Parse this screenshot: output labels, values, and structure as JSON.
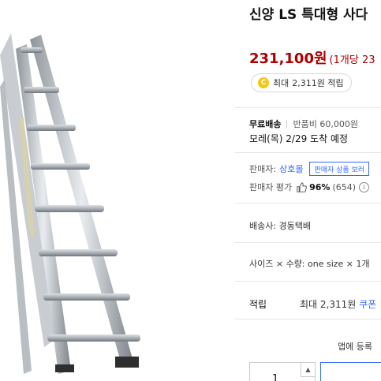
{
  "product": {
    "title": "신양 LS 특대형 사다",
    "price": "231,100원",
    "unit_price": "(1개당 23",
    "reward_label": "최대",
    "reward_amount": "2,311원 적립",
    "coin_symbol": "C"
  },
  "shipping": {
    "free": "무료배송",
    "return_fee": "반품비 60,000원",
    "arrival": "모레(목) 2/29 도착 예정"
  },
  "seller": {
    "label": "판매자:",
    "name": "상호몰",
    "tooltip": "판매자 상품 보러",
    "rating_label": "판매자 평가",
    "rating_pct": "96%",
    "rating_count": "(654)",
    "info_symbol": "i"
  },
  "delivery": {
    "text": "배송사: 경동택배"
  },
  "options": {
    "text": "사이즈 × 수량: one size × 1개"
  },
  "rewards": {
    "label": "적립",
    "value": "최대 2,311원 ",
    "link": "쿠폰"
  },
  "app": {
    "text": "앱에 등록"
  },
  "quantity": {
    "value": "1",
    "up_symbol": "▲"
  },
  "colors": {
    "price_red": "#ae0000",
    "link_blue": "#346aff",
    "coin_gold": "#f5c518"
  },
  "icons": {
    "coin": "coin-icon",
    "thumb": "thumbs-up-icon",
    "info": "info-circle-icon",
    "up": "chevron-up-icon"
  }
}
